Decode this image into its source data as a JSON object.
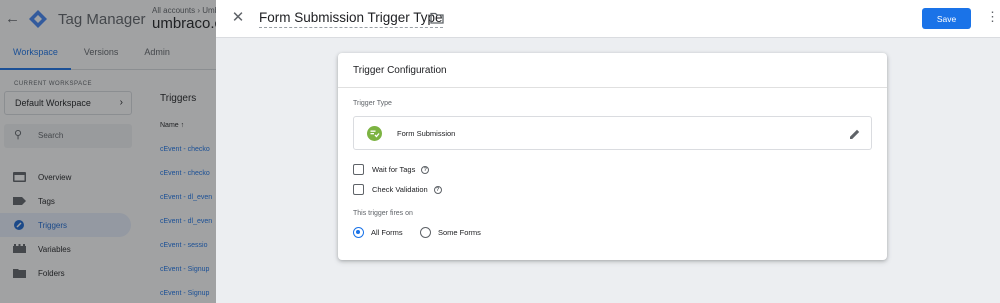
{
  "app": {
    "name": "Tag Manager",
    "account_crumb": "All accounts › Umb",
    "container_name": "umbraco.c",
    "tabs": [
      {
        "label": "Workspace",
        "active": true
      },
      {
        "label": "Versions",
        "active": false
      },
      {
        "label": "Admin",
        "active": false
      }
    ]
  },
  "sidebar": {
    "current_workspace_label": "CURRENT WORKSPACE",
    "workspace_name": "Default Workspace",
    "search_placeholder": "Search",
    "items": [
      {
        "label": "Overview",
        "icon": "overview-icon",
        "active": false
      },
      {
        "label": "Tags",
        "icon": "tag-icon",
        "active": false
      },
      {
        "label": "Triggers",
        "icon": "trigger-icon",
        "active": true
      },
      {
        "label": "Variables",
        "icon": "variables-icon",
        "active": false
      },
      {
        "label": "Folders",
        "icon": "folder-icon",
        "active": false
      }
    ]
  },
  "triggers_list": {
    "title": "Triggers",
    "column_name": "Name ↑",
    "rows": [
      "cEvent - checko",
      "cEvent - checko",
      "cEvent - dl_even",
      "cEvent - dl_even",
      "cEvent - sessio",
      "cEvent - Signup",
      "cEvent - Signup"
    ]
  },
  "panel": {
    "title": "Form Submission Trigger Type",
    "save_label": "Save",
    "card_title": "Trigger Configuration",
    "trigger_type_label": "Trigger Type",
    "trigger_type_name": "Form Submission",
    "wait_for_tags_label": "Wait for Tags",
    "check_validation_label": "Check Validation",
    "fires_on_label": "This trigger fires on",
    "all_forms_label": "All Forms",
    "some_forms_label": "Some Forms",
    "fires_on_selected": "All Forms",
    "trigger_icon_color": "#7cb342",
    "accent_color": "#1a73e8"
  }
}
